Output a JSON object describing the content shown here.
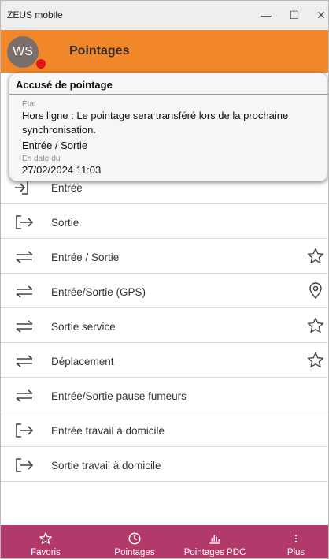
{
  "window": {
    "title": "ZEUS mobile",
    "controls": {
      "minimize": "—",
      "maximize": "☐",
      "close": "✕"
    }
  },
  "header": {
    "avatar_initials": "WS",
    "title": "Pointages",
    "colors": {
      "bar": "#f0882a",
      "avatar": "#7a6f6a",
      "status_dot": "#e0141e"
    }
  },
  "receipt": {
    "title": "Accusé de pointage",
    "state_label": "État",
    "state_value": "Hors ligne : Le pointage sera transféré lors de la prochaine synchronisation.",
    "type_value": "Entrée / Sortie",
    "date_label": "En date du",
    "date_value": "27/02/2024 11:03"
  },
  "list": {
    "items": [
      {
        "label": "Entrée",
        "icon": "entry-icon",
        "action_icon": ""
      },
      {
        "label": "Sortie",
        "icon": "exit-icon",
        "action_icon": ""
      },
      {
        "label": "Entrée / Sortie",
        "icon": "swap-arrows-icon",
        "action_icon": "star-icon"
      },
      {
        "label": "Entrée/Sortie (GPS)",
        "icon": "swap-arrows-icon",
        "action_icon": "location-pin-icon"
      },
      {
        "label": "Sortie service",
        "icon": "swap-arrows-icon",
        "action_icon": "star-icon"
      },
      {
        "label": "Déplacement",
        "icon": "swap-arrows-icon",
        "action_icon": "star-icon"
      },
      {
        "label": "Entrée/Sortie pause fumeurs",
        "icon": "swap-arrows-icon",
        "action_icon": ""
      },
      {
        "label": "Entrée travail à domicile",
        "icon": "exit-icon",
        "action_icon": ""
      },
      {
        "label": "Sortie travail à domicile",
        "icon": "exit-icon",
        "action_icon": ""
      }
    ]
  },
  "bottom_nav": {
    "color": "#b13a6a",
    "items": [
      {
        "label": "Favoris",
        "icon": "star-icon"
      },
      {
        "label": "Pointages",
        "icon": "clock-icon"
      },
      {
        "label": "Pointages PDC",
        "icon": "bar-chart-icon"
      },
      {
        "label": "Plus",
        "icon": "more-vertical-icon"
      }
    ]
  }
}
